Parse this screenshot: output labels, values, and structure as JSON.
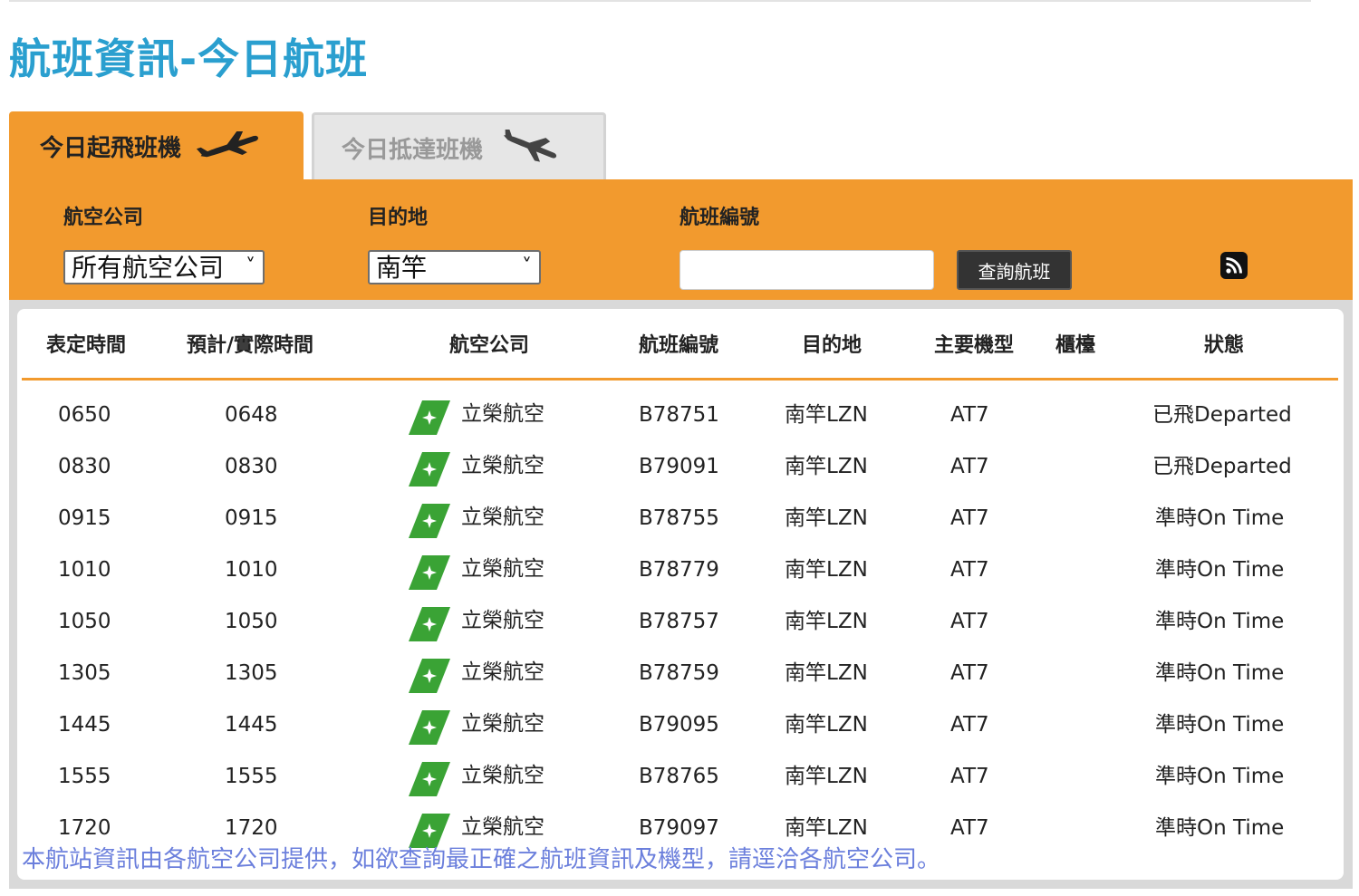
{
  "page_title": "航班資訊-今日航班",
  "tabs": {
    "departures": "今日起飛班機",
    "arrivals": "今日抵達班機"
  },
  "filters": {
    "airline_label": "航空公司",
    "airline_value": "所有航空公司",
    "destination_label": "目的地",
    "destination_value": "南竿",
    "flight_no_label": "航班編號",
    "flight_no_value": "",
    "search_button": "查詢航班"
  },
  "table": {
    "headers": [
      "表定時間",
      "預計/實際時間",
      "航空公司",
      "航班編號",
      "目的地",
      "主要機型",
      "櫃檯",
      "狀態"
    ],
    "rows": [
      {
        "scheduled": "0650",
        "actual": "0648",
        "airline": "立榮航空",
        "flight": "B78751",
        "destination": "南竿LZN",
        "aircraft": "AT7",
        "counter": "",
        "status": "已飛Departed"
      },
      {
        "scheduled": "0830",
        "actual": "0830",
        "airline": "立榮航空",
        "flight": "B79091",
        "destination": "南竿LZN",
        "aircraft": "AT7",
        "counter": "",
        "status": "已飛Departed"
      },
      {
        "scheduled": "0915",
        "actual": "0915",
        "airline": "立榮航空",
        "flight": "B78755",
        "destination": "南竿LZN",
        "aircraft": "AT7",
        "counter": "",
        "status": "準時On Time"
      },
      {
        "scheduled": "1010",
        "actual": "1010",
        "airline": "立榮航空",
        "flight": "B78779",
        "destination": "南竿LZN",
        "aircraft": "AT7",
        "counter": "",
        "status": "準時On Time"
      },
      {
        "scheduled": "1050",
        "actual": "1050",
        "airline": "立榮航空",
        "flight": "B78757",
        "destination": "南竿LZN",
        "aircraft": "AT7",
        "counter": "",
        "status": "準時On Time"
      },
      {
        "scheduled": "1305",
        "actual": "1305",
        "airline": "立榮航空",
        "flight": "B78759",
        "destination": "南竿LZN",
        "aircraft": "AT7",
        "counter": "",
        "status": "準時On Time"
      },
      {
        "scheduled": "1445",
        "actual": "1445",
        "airline": "立榮航空",
        "flight": "B79095",
        "destination": "南竿LZN",
        "aircraft": "AT7",
        "counter": "",
        "status": "準時On Time"
      },
      {
        "scheduled": "1555",
        "actual": "1555",
        "airline": "立榮航空",
        "flight": "B78765",
        "destination": "南竿LZN",
        "aircraft": "AT7",
        "counter": "",
        "status": "準時On Time"
      },
      {
        "scheduled": "1720",
        "actual": "1720",
        "airline": "立榮航空",
        "flight": "B79097",
        "destination": "南竿LZN",
        "aircraft": "AT7",
        "counter": "",
        "status": "準時On Time"
      }
    ]
  },
  "footnote": "本航站資訊由各航空公司提供，如欲查詢最正確之航班資訊及機型，請逕洽各航空公司。",
  "icons": {
    "departures_tab": "plane-takeoff-icon",
    "arrivals_tab": "plane-landing-icon",
    "rss": "rss-icon",
    "airline_logo": "uni-air-logo"
  },
  "colors": {
    "accent": "#f29a2e",
    "title": "#2a9fcf",
    "footnote": "#6b7fdc",
    "logo_green": "#3aa335"
  }
}
